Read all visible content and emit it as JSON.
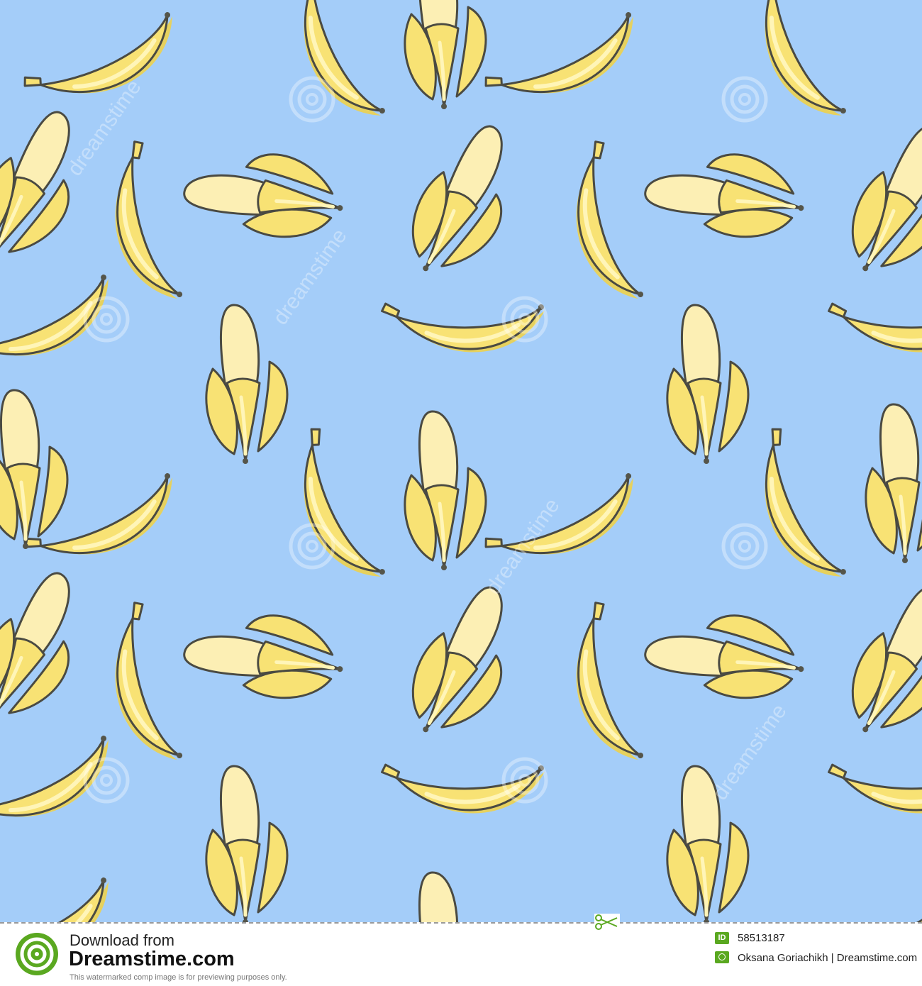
{
  "image": {
    "subject": "seamless pattern of yellow bananas, whole and half-peeled, on a light blue background",
    "colors": {
      "background": "#a4cdf9",
      "banana": "#f8e274",
      "banana_light": "#fff5b8",
      "peel_inner": "#fcefb4",
      "shadow": "#e6d15e",
      "outline": "#4a4a42",
      "tip": "#55554a"
    },
    "watermark": "dreamstime"
  },
  "footer": {
    "download_from": "Download from",
    "site": "Dreamstime.com",
    "note": "This watermarked comp image is for previewing purposes only.",
    "id_label": "ID",
    "id_number": "58513187",
    "credit": "Oksana Goriachikh | Dreamstime.com",
    "accent_color": "#5aa820"
  }
}
